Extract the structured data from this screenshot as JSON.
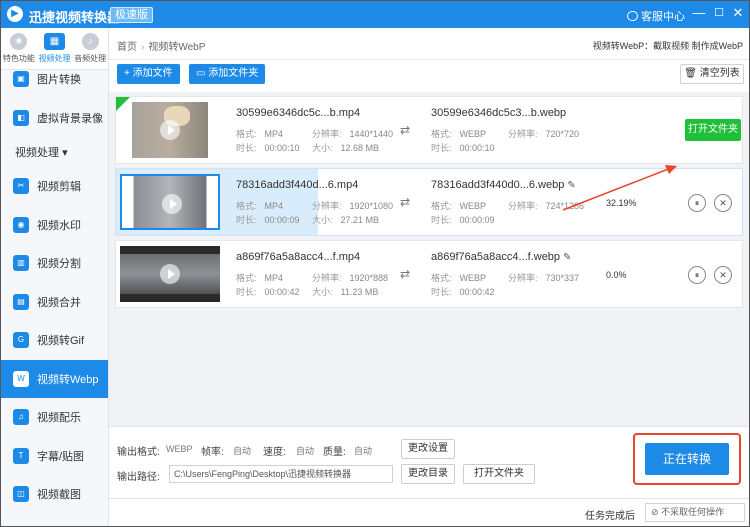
{
  "app": {
    "title": "迅捷视频转换器",
    "edition": "极速版",
    "service": "客服中心",
    "min": "—",
    "max": "☐",
    "close": "✕"
  },
  "sidebar": {
    "top_tabs": [
      {
        "label": "特色功能",
        "icon": "star-icon"
      },
      {
        "label": "视频处理",
        "icon": "film-icon"
      },
      {
        "label": "音频处理",
        "icon": "audio-icon"
      }
    ],
    "items": [
      {
        "label": "图片转换",
        "icon": "image-convert-icon",
        "active": false
      },
      {
        "label": "虚拟背景录像",
        "icon": "virtual-bg-icon",
        "active": false
      }
    ],
    "group": {
      "label": "视频处理",
      "caret": "▾"
    },
    "video_items": [
      {
        "label": "视频剪辑",
        "icon": "video-cut-icon",
        "active": false
      },
      {
        "label": "视频水印",
        "icon": "watermark-icon",
        "active": false
      },
      {
        "label": "视频分割",
        "icon": "video-split-icon",
        "active": false
      },
      {
        "label": "视频合并",
        "icon": "video-merge-icon",
        "active": false
      },
      {
        "label": "视频转Gif",
        "icon": "gif-icon",
        "active": false
      },
      {
        "label": "视频转Webp",
        "icon": "webp-icon",
        "active": true
      },
      {
        "label": "视频配乐",
        "icon": "music-icon",
        "active": false
      },
      {
        "label": "字幕/贴图",
        "icon": "subtitle-icon",
        "active": false
      },
      {
        "label": "视频截图",
        "icon": "screenshot-icon",
        "active": false
      }
    ]
  },
  "breadcrumb": {
    "home": "首页",
    "sep": "›",
    "current": "视频转WebP"
  },
  "header_note": "视频转WebP：截取视频 制作成WebP",
  "toolbar": {
    "add_file": "+ 添加文件",
    "add_folder": "添加文件夹",
    "clear": "清空列表"
  },
  "labels": {
    "format": "格式:",
    "resolution": "分辨率:",
    "duration": "时长:",
    "size": "大小:",
    "arrow": "⇄",
    "pen": "✎",
    "pause": "⏸",
    "remove": "✕",
    "check": "✓"
  },
  "files": [
    {
      "src_name": "30599e6346dc5c...b.mp4",
      "format": "MP4",
      "resolution": "1440*1440",
      "duration": "00:00:10",
      "size": "12.68 MB",
      "dst_name": "30599e6346dc5c3...b.webp",
      "dst_format": "WEBP",
      "dst_resolution": "720*720",
      "dst_duration": "00:00:10",
      "progress_text": "",
      "action": "打开文件夹",
      "done": true
    },
    {
      "src_name": "78316add3f440d...6.mp4",
      "format": "MP4",
      "resolution": "1920*1080",
      "duration": "00:00:09",
      "size": "27.21 MB",
      "dst_name": "78316add3f440d0...6.webp",
      "dst_format": "WEBP",
      "dst_resolution": "724*1286",
      "dst_duration": "00:00:09",
      "progress_text": "32.19%",
      "progress": 0.3219
    },
    {
      "src_name": "a869f76a5a8acc4...f.mp4",
      "format": "MP4",
      "resolution": "1920*888",
      "duration": "00:00:42",
      "size": "11.23 MB",
      "dst_name": "a869f76a5a8acc4...f.webp",
      "dst_format": "WEBP",
      "dst_resolution": "730*337",
      "dst_duration": "00:00:42",
      "progress_text": "0.0%",
      "progress": 0
    }
  ],
  "output": {
    "format_label": "输出格式:",
    "format_value": "WEBP",
    "fps_label": "帧率:",
    "fps_value": "自动",
    "speed_label": "速度:",
    "speed_value": "自动",
    "quality_label": "质量:",
    "quality_value": "自动",
    "change_settings": "更改设置",
    "path_label": "输出路径:",
    "path_value": "C:\\Users\\FengPing\\Desktop\\迅捷视频转换器",
    "change_dir": "更改目录",
    "open_folder": "打开文件夹",
    "convert_button": "正在转换"
  },
  "status": {
    "after_label": "任务完成后",
    "after_value": "⊘ 不采取任何操作"
  },
  "colors": {
    "primary": "#1e8ae8",
    "green": "#1fbf3a",
    "highlight": "#e8452b"
  }
}
